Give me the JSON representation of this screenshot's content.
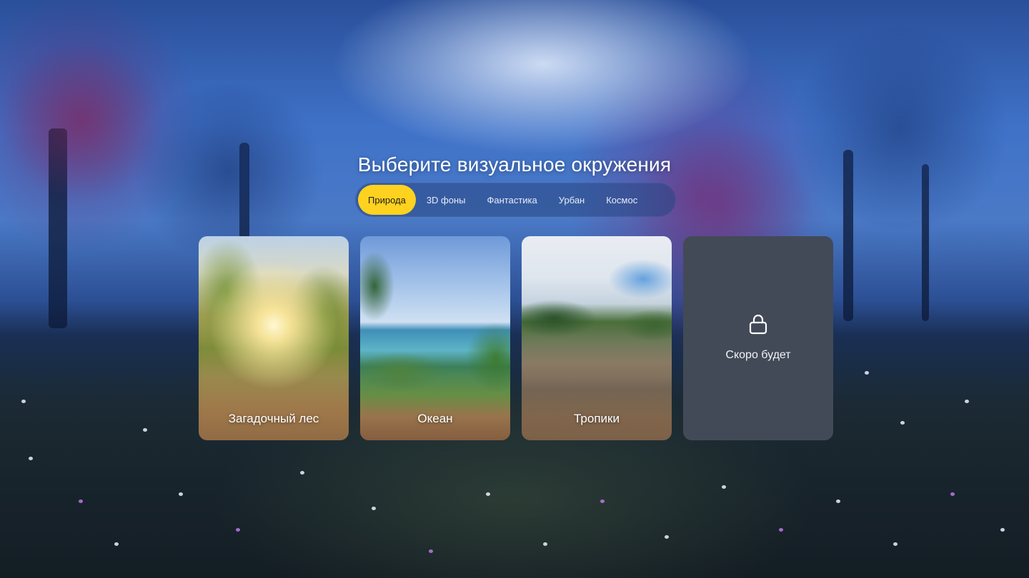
{
  "title": "Выберите визуальное окружения",
  "tabs": [
    {
      "label": "Природа",
      "active": true
    },
    {
      "label": "3D фоны",
      "active": false
    },
    {
      "label": "Фантастика",
      "active": false
    },
    {
      "label": "Урбан",
      "active": false
    },
    {
      "label": "Космос",
      "active": false
    }
  ],
  "cards": [
    {
      "label": "Загадочный лес",
      "locked": false
    },
    {
      "label": "Океан",
      "locked": false
    },
    {
      "label": "Тропики",
      "locked": false
    },
    {
      "label": "Скоро будет",
      "locked": true,
      "icon": "lock-icon"
    }
  ],
  "colors": {
    "accent": "#ffd21f",
    "locked_card": "#424a57"
  }
}
